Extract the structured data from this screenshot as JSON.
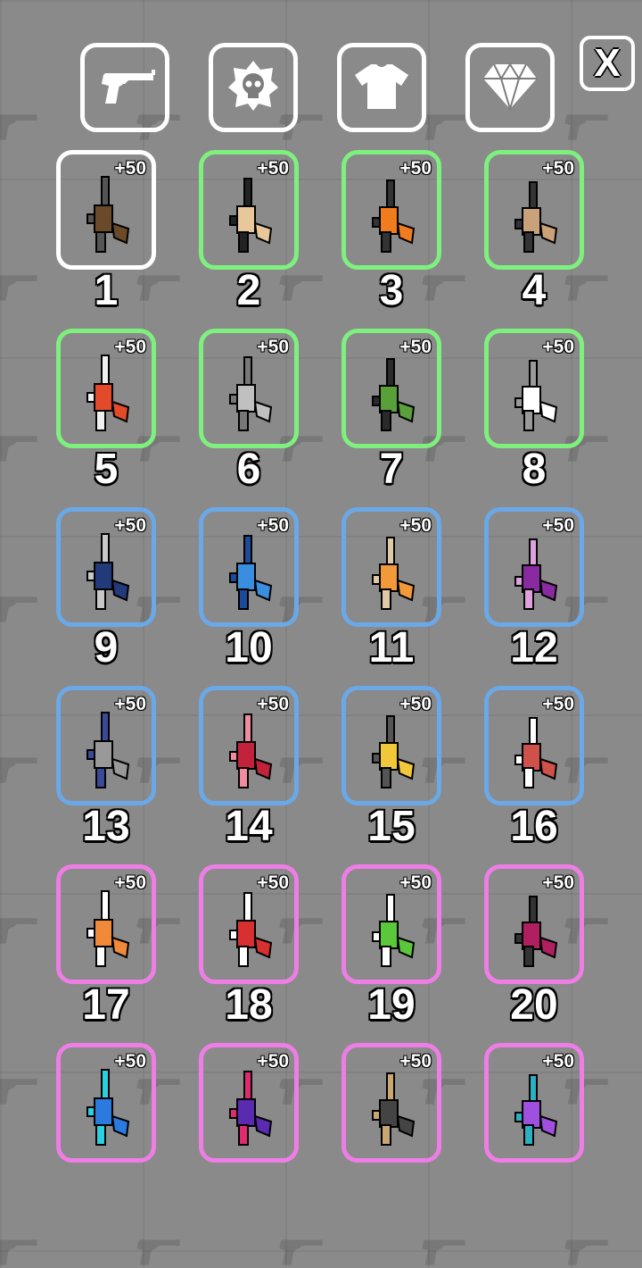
{
  "tabs": [
    {
      "name": "weapons",
      "icon": "revolver-icon"
    },
    {
      "name": "skins",
      "icon": "skull-badge-icon"
    },
    {
      "name": "outfits",
      "icon": "tshirt-icon"
    },
    {
      "name": "gems",
      "icon": "diamond-icon"
    }
  ],
  "close_label": "X",
  "colors": {
    "common": "#ffffff",
    "uncommon": "#7ef07e",
    "rare": "#6aa8e8",
    "epic": "#ee7de6"
  },
  "items": [
    {
      "number": "1",
      "bonus": "+50",
      "rarity": "common",
      "gun": [
        "#6b4a2a",
        "#555555"
      ]
    },
    {
      "number": "2",
      "bonus": "+50",
      "rarity": "uncommon",
      "gun": [
        "#e8c89a",
        "#222222"
      ]
    },
    {
      "number": "3",
      "bonus": "+50",
      "rarity": "uncommon",
      "gun": [
        "#f07c1e",
        "#333333"
      ]
    },
    {
      "number": "4",
      "bonus": "+50",
      "rarity": "uncommon",
      "gun": [
        "#c9a27a",
        "#333333"
      ]
    },
    {
      "number": "5",
      "bonus": "+50",
      "rarity": "uncommon",
      "gun": [
        "#e24a2a",
        "#f0f0f0"
      ]
    },
    {
      "number": "6",
      "bonus": "+50",
      "rarity": "uncommon",
      "gun": [
        "#c0c0c0",
        "#777777"
      ]
    },
    {
      "number": "7",
      "bonus": "+50",
      "rarity": "uncommon",
      "gun": [
        "#5aa03a",
        "#2a2a2a"
      ]
    },
    {
      "number": "8",
      "bonus": "+50",
      "rarity": "uncommon",
      "gun": [
        "#ffffff",
        "#999999"
      ]
    },
    {
      "number": "9",
      "bonus": "+50",
      "rarity": "rare",
      "gun": [
        "#233a7a",
        "#c8c8c8"
      ]
    },
    {
      "number": "10",
      "bonus": "+50",
      "rarity": "rare",
      "gun": [
        "#3a8ee0",
        "#1e4a9a"
      ]
    },
    {
      "number": "11",
      "bonus": "+50",
      "rarity": "rare",
      "gun": [
        "#f29a3a",
        "#e0c9a8"
      ]
    },
    {
      "number": "12",
      "bonus": "+50",
      "rarity": "rare",
      "gun": [
        "#8a2aa0",
        "#e0a0e0"
      ]
    },
    {
      "number": "13",
      "bonus": "+50",
      "rarity": "rare",
      "gun": [
        "#999999",
        "#3a4a9a"
      ]
    },
    {
      "number": "14",
      "bonus": "+50",
      "rarity": "rare",
      "gun": [
        "#c2223a",
        "#f08ca0"
      ]
    },
    {
      "number": "15",
      "bonus": "+50",
      "rarity": "rare",
      "gun": [
        "#f0c83a",
        "#555555"
      ]
    },
    {
      "number": "16",
      "bonus": "+50",
      "rarity": "rare",
      "gun": [
        "#d0504a",
        "#ffffff"
      ]
    },
    {
      "number": "17",
      "bonus": "+50",
      "rarity": "epic",
      "gun": [
        "#f08a3a",
        "#ffffff"
      ]
    },
    {
      "number": "18",
      "bonus": "+50",
      "rarity": "epic",
      "gun": [
        "#d83030",
        "#ffffff"
      ]
    },
    {
      "number": "19",
      "bonus": "+50",
      "rarity": "epic",
      "gun": [
        "#5ac83a",
        "#ffffff"
      ]
    },
    {
      "number": "20",
      "bonus": "+50",
      "rarity": "epic",
      "gun": [
        "#b02060",
        "#333333"
      ]
    },
    {
      "number": "",
      "bonus": "+50",
      "rarity": "epic",
      "gun": [
        "#2a7ae0",
        "#2ad0e0"
      ]
    },
    {
      "number": "",
      "bonus": "+50",
      "rarity": "epic",
      "gun": [
        "#5a2ab0",
        "#e02a70"
      ]
    },
    {
      "number": "",
      "bonus": "+50",
      "rarity": "epic",
      "gun": [
        "#444444",
        "#c8a870"
      ]
    },
    {
      "number": "",
      "bonus": "+50",
      "rarity": "epic",
      "gun": [
        "#a050e0",
        "#2ab0c0"
      ]
    }
  ]
}
